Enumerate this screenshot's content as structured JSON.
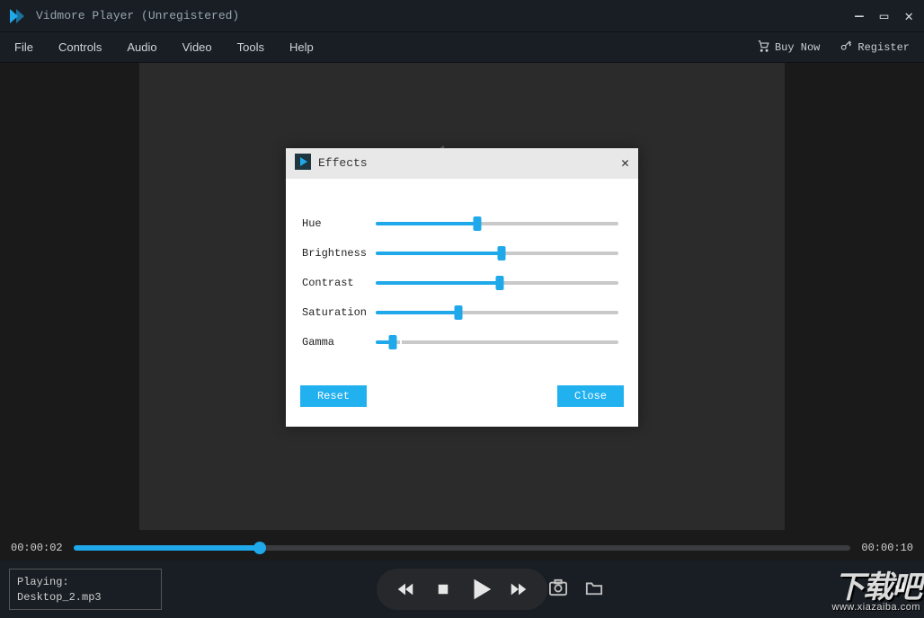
{
  "window": {
    "title": "Vidmore Player (Unregistered)"
  },
  "menu": {
    "items": [
      "File",
      "Controls",
      "Audio",
      "Video",
      "Tools",
      "Help"
    ],
    "buy": "Buy Now",
    "register": "Register"
  },
  "effects": {
    "title": "Effects",
    "sliders": [
      {
        "label": "Hue",
        "percent": 42
      },
      {
        "label": "Brightness",
        "percent": 52
      },
      {
        "label": "Contrast",
        "percent": 51
      },
      {
        "label": "Saturation",
        "percent": 34
      },
      {
        "label": "Gamma",
        "percent": 7
      }
    ],
    "reset": "Reset",
    "close": "Close"
  },
  "timeline": {
    "current": "00:00:02",
    "total": "00:00:10",
    "percent": 24
  },
  "nowplaying": {
    "label": "Playing:",
    "file": "Desktop_2.mp3"
  },
  "watermark": {
    "text": "下载吧",
    "url": "www.xiazaiba.com"
  }
}
